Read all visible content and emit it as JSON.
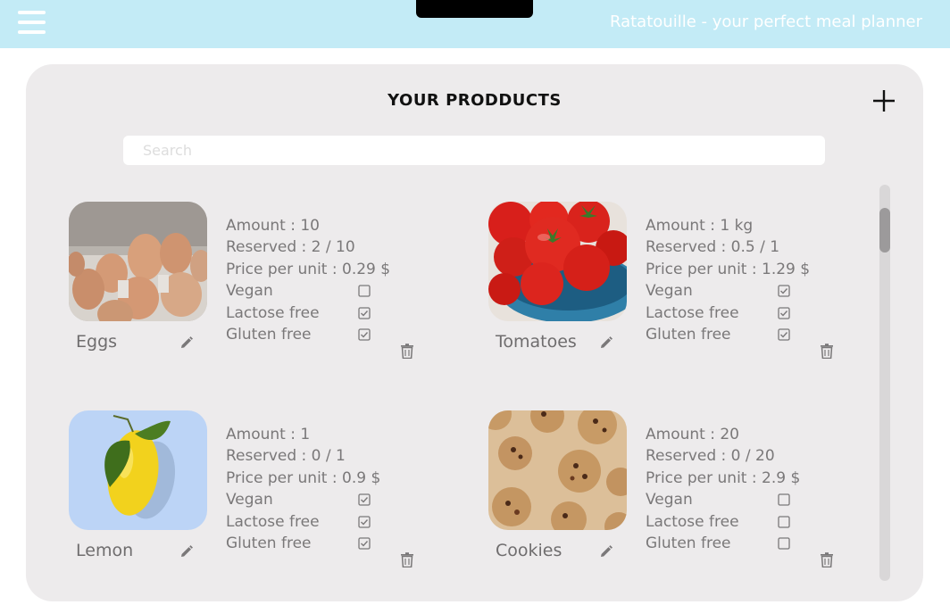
{
  "app": {
    "title": "Ratatouille - your perfect meal planner"
  },
  "panel": {
    "title": "YOUR PRODDUCTS"
  },
  "search": {
    "placeholder": "Search"
  },
  "labels": {
    "amount": "Amount : ",
    "reserved": "Reserved : ",
    "price": "Price per unit : ",
    "vegan": "Vegan",
    "lactose": "Lactose free",
    "gluten": "Gluten free"
  },
  "products": [
    {
      "name": "Eggs",
      "image": "eggs-photo",
      "amount": "10",
      "reserved": "2 / 10",
      "price": "0.29 $",
      "vegan": false,
      "lactose_free": true,
      "gluten_free": true
    },
    {
      "name": "Tomatoes",
      "image": "tomatoes-photo",
      "amount": "1 kg",
      "reserved": "0.5 / 1",
      "price": "1.29 $",
      "vegan": true,
      "lactose_free": true,
      "gluten_free": true
    },
    {
      "name": "Lemon",
      "image": "lemon-photo",
      "amount": "1",
      "reserved": "0 / 1",
      "price": "0.9 $",
      "vegan": true,
      "lactose_free": true,
      "gluten_free": true
    },
    {
      "name": "Cookies",
      "image": "cookies-photo",
      "amount": "20",
      "reserved": "0 / 20",
      "price": "2.9 $",
      "vegan": false,
      "lactose_free": false,
      "gluten_free": false
    }
  ],
  "colors": {
    "topbar": "#c3ebf6",
    "panel": "#edebec",
    "text": "#7a7879",
    "accent": "#111111"
  }
}
